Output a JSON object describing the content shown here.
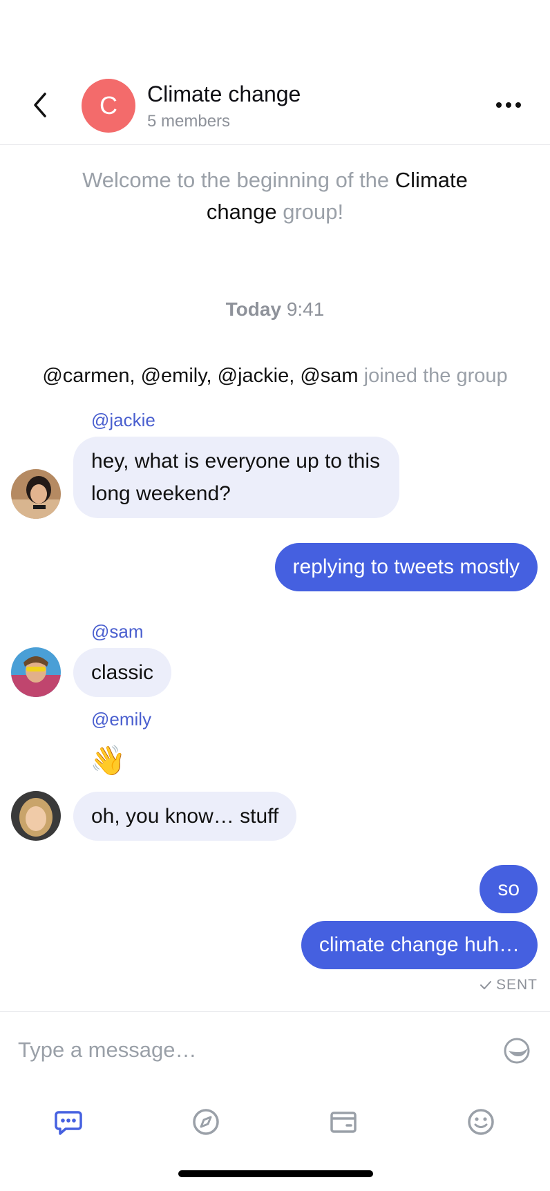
{
  "header": {
    "avatar_letter": "C",
    "title": "Climate change",
    "subtitle": "5 members"
  },
  "welcome": {
    "prefix": "Welcome to the beginning of the ",
    "group_name": "Climate change",
    "suffix": " group!"
  },
  "timestamp": {
    "day": "Today",
    "time": "9:41"
  },
  "joined_notice": {
    "users": "@carmen, @emily, @jackie, @sam",
    "text": " joined the group"
  },
  "messages": [
    {
      "author": "@jackie",
      "text": "hey, what is everyone up to this long weekend?"
    },
    {
      "text": "replying to tweets mostly"
    },
    {
      "author": "@sam",
      "text": "classic"
    },
    {
      "author": "@emily",
      "text": "👋"
    },
    {
      "text": "oh, you know… stuff"
    },
    {
      "text": "so"
    },
    {
      "text": "climate change huh…"
    }
  ],
  "sent_status": "SENT",
  "composer": {
    "placeholder": "Type a message…"
  },
  "colors": {
    "accent": "#4560E0",
    "incoming_bubble": "#ECEEFA",
    "group_avatar": "#F36B6B",
    "muted_text": "#9AA0A8"
  },
  "icons": {
    "back": "chevron-left-icon",
    "more": "more-horizontal-icon",
    "sticker": "sticker-icon",
    "tabs": [
      "chat-icon",
      "compass-icon",
      "wallet-icon",
      "smiley-icon"
    ]
  }
}
